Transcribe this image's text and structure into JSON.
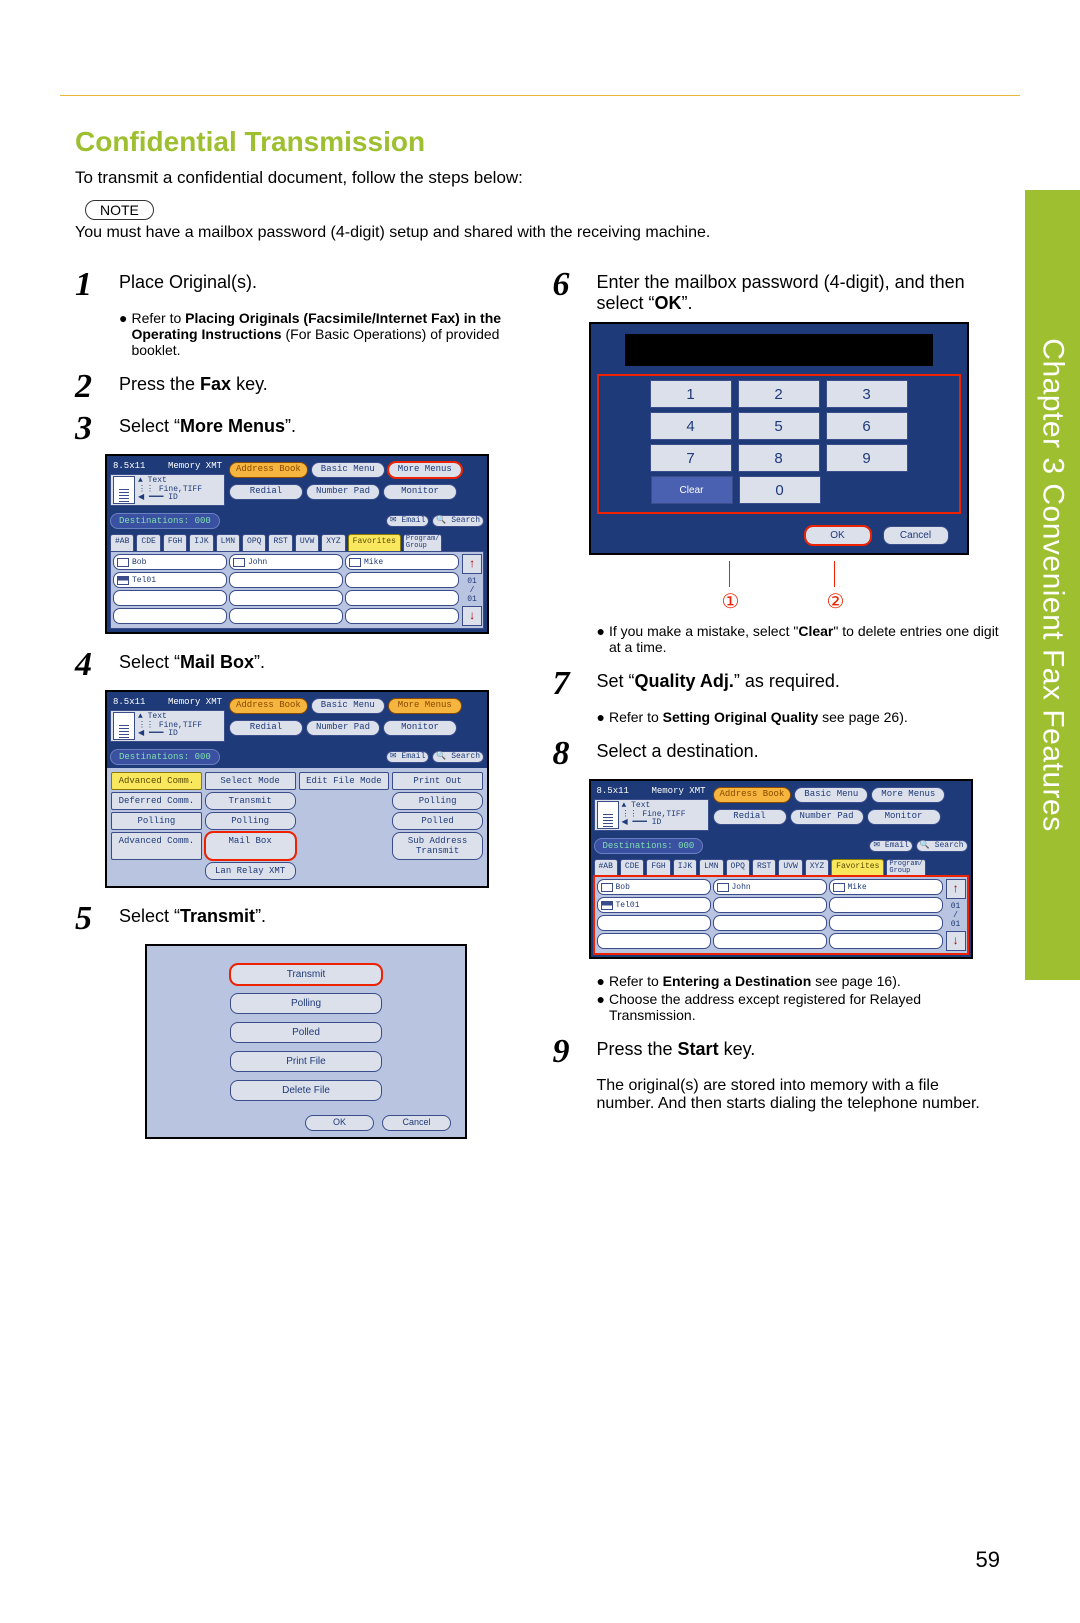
{
  "side_tab": "Chapter 3   Convenient Fax Features",
  "section_title": "Confidential Transmission",
  "intro": "To transmit a confidential document, follow the steps below:",
  "note_label": "NOTE",
  "note_text": "You must have a mailbox password (4-digit) setup and shared with the receiving machine.",
  "steps": {
    "1": {
      "text": "Place Original(s)."
    },
    "1_sub": {
      "text_pre": "Refer to ",
      "bold": "Placing Originals (Facsimile/Internet Fax) in the Operating Instructions",
      "text_post": " (For Basic Operations) of provided booklet."
    },
    "2": {
      "pre": "Press the ",
      "bold": "Fax",
      "post": " key."
    },
    "3": {
      "pre": "Select “",
      "bold": "More Menus",
      "post": "”."
    },
    "4": {
      "pre": "Select “",
      "bold": "Mail Box",
      "post": "”."
    },
    "5": {
      "pre": "Select “",
      "bold": "Transmit",
      "post": "”."
    },
    "6": {
      "pre": "Enter the mailbox password (4-digit), and then select “",
      "bold": "OK",
      "post": "”."
    },
    "6_sub": {
      "pre": "If you make a mistake, select \"",
      "bold": "Clear",
      "post": "\" to delete entries one digit at a time."
    },
    "7": {
      "pre": "Set “",
      "bold": "Quality Adj.",
      "post": "” as required."
    },
    "7_sub": {
      "pre": "Refer to ",
      "bold": "Setting Original Quality",
      "post": " see page 26)."
    },
    "8": {
      "text": "Select a destination."
    },
    "8_sub_a": {
      "pre": "Refer to ",
      "bold": "Entering a Destination",
      "post": " see page 16)."
    },
    "8_sub_b": {
      "text": "Choose the address except registered for Relayed Transmission."
    },
    "9": {
      "pre": "Press the ",
      "bold": "Start",
      "post": " key."
    },
    "9_sub": {
      "text": "The original(s) are stored into memory with a file number. And then starts dialing the telephone number."
    }
  },
  "callouts": {
    "one": "①",
    "two": "②"
  },
  "page_number": "59",
  "ui": {
    "paper": "8.5x11",
    "memory": "Memory XMT",
    "quality_a": "Text",
    "quality_b": "Fine,TIFF",
    "id_label": "ID",
    "addr_book": "Address Book",
    "basic_menu": "Basic Menu",
    "more_menus": "More Menus",
    "redial": "Redial",
    "number_pad": "Number Pad",
    "monitor": "Monitor",
    "email": "Email",
    "search": "Search",
    "dest_label": "Destinations: 000",
    "tabs": [
      "#AB",
      "CDE",
      "FGH",
      "IJK",
      "LMN",
      "OPQ",
      "RST",
      "UVW",
      "XYZ",
      "Favorites"
    ],
    "program_group": "Program/\nGroup",
    "contacts": [
      "Bob",
      "John",
      "Mike",
      "Tel01"
    ],
    "scroll_count": "01\n/\n01",
    "mailbox_headers": [
      "Advanced Comm.",
      "Select Mode",
      "Edit File Mode",
      "Print Out"
    ],
    "mailbox_rows": [
      [
        "Deferred Comm.",
        "Transmit",
        "",
        "Polling"
      ],
      [
        "Polling",
        "Polling",
        "",
        "Polled"
      ],
      [
        "Advanced Comm.",
        "Mail Box",
        "",
        "Sub Address Transmit"
      ],
      [
        "",
        "Lan Relay XMT",
        "",
        ""
      ]
    ],
    "transmit_list": [
      "Transmit",
      "Polling",
      "Polled",
      "Print File",
      "Delete File"
    ],
    "ok": "OK",
    "cancel": "Cancel",
    "keypad": [
      "1",
      "2",
      "3",
      "4",
      "5",
      "6",
      "7",
      "8",
      "9",
      "Clear",
      "0"
    ]
  }
}
